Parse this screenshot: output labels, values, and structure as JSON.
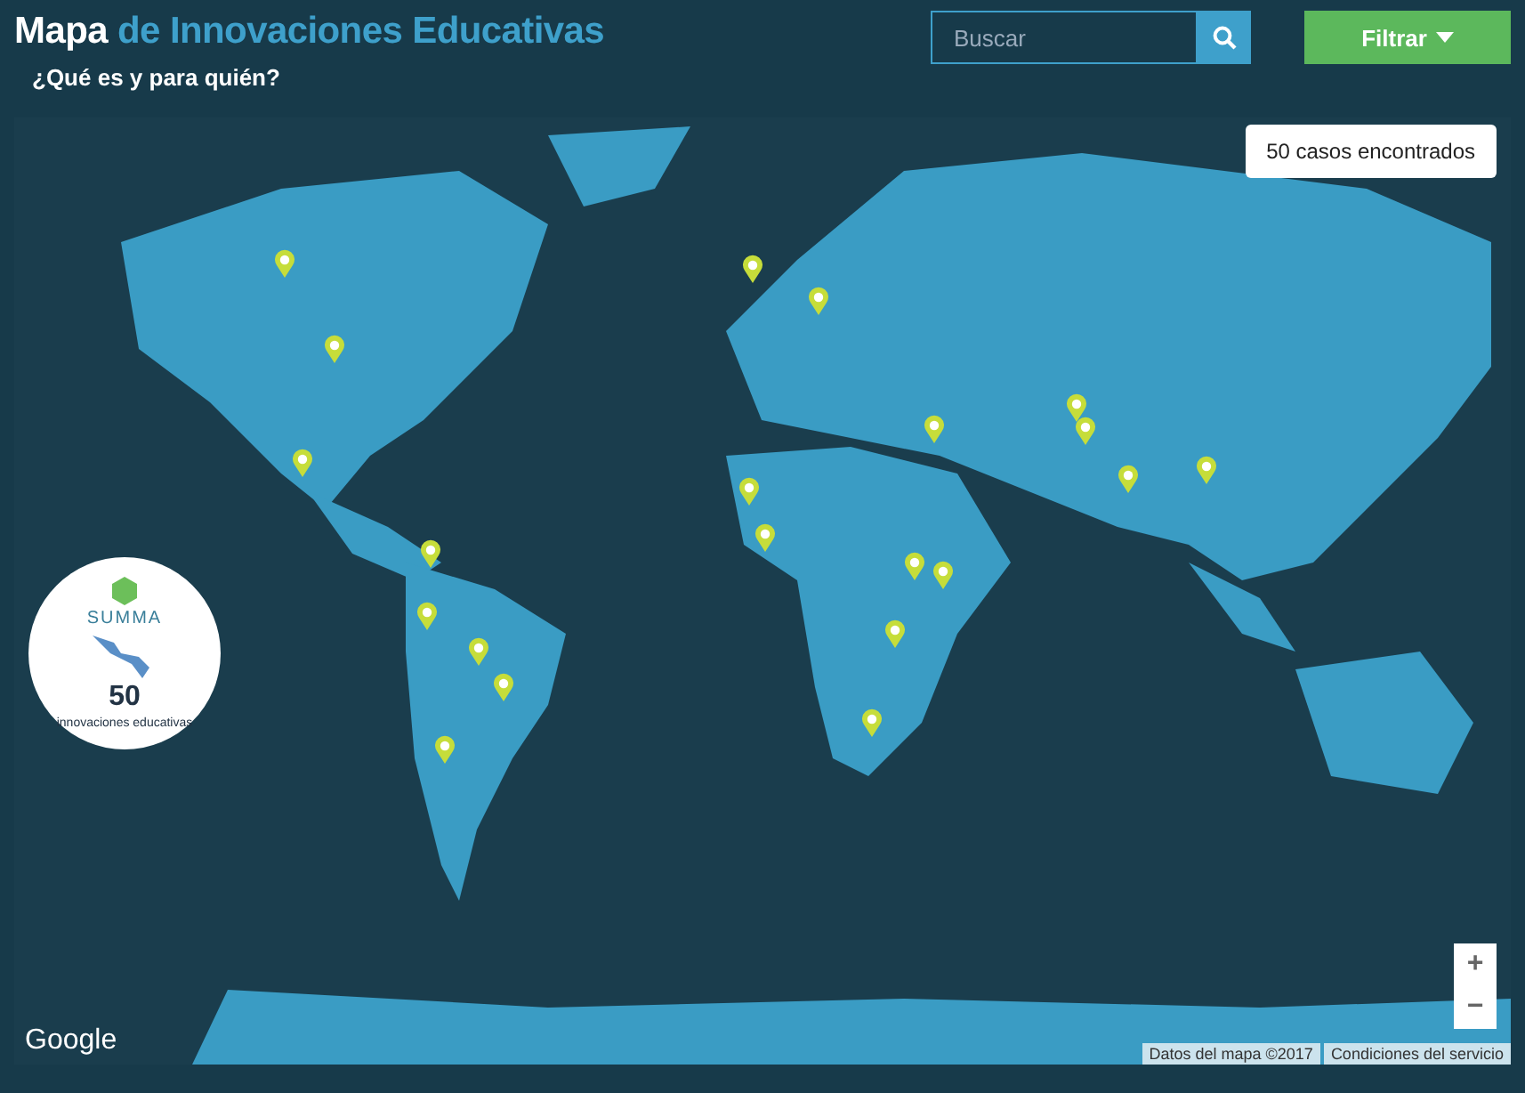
{
  "header": {
    "title_first": "Mapa",
    "title_rest": "de Innovaciones Educativas",
    "subtitle": "¿Qué es y para quién?"
  },
  "search": {
    "placeholder": "Buscar"
  },
  "filter_button": {
    "label": "Filtrar"
  },
  "map": {
    "results_count": "50 casos encontrados",
    "badge": {
      "brand": "SUMMA",
      "number": "50",
      "caption": "innovaciones educativas"
    },
    "provider_logo": "Google",
    "zoom_in": "+",
    "zoom_out": "−",
    "attribution": [
      "Datos del mapa ©2017",
      "Condiciones del servicio"
    ]
  }
}
